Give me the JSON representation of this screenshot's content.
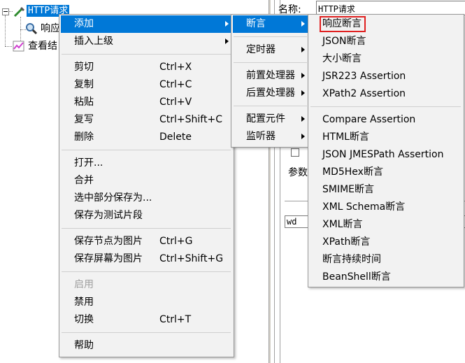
{
  "tree": {
    "items": [
      {
        "label": "HTTP请求",
        "icon": "pipette-icon",
        "selected": true
      },
      {
        "label": "响应",
        "icon": "magnifier-icon"
      },
      {
        "label": "查看结",
        "icon": "graph-icon"
      }
    ]
  },
  "right_panel": {
    "name_label": "名称:",
    "name_value": "HTTP请求",
    "params_label": "参数",
    "field_value": "wd"
  },
  "main_menu": [
    {
      "label": "添加",
      "submenu": true,
      "highlighted": true
    },
    {
      "label": "插入上级",
      "submenu": true
    },
    {
      "separator": true
    },
    {
      "label": "剪切",
      "shortcut": "Ctrl+X"
    },
    {
      "label": "复制",
      "shortcut": "Ctrl+C"
    },
    {
      "label": "粘贴",
      "shortcut": "Ctrl+V"
    },
    {
      "label": "复写",
      "shortcut": "Ctrl+Shift+C"
    },
    {
      "label": "删除",
      "shortcut": "Delete"
    },
    {
      "separator": true
    },
    {
      "label": "打开..."
    },
    {
      "label": "合并"
    },
    {
      "label": "选中部分保存为..."
    },
    {
      "label": "保存为测试片段"
    },
    {
      "separator": true
    },
    {
      "label": "保存节点为图片",
      "shortcut": "Ctrl+G"
    },
    {
      "label": "保存屏幕为图片",
      "shortcut": "Ctrl+Shift+G"
    },
    {
      "separator": true
    },
    {
      "label": "启用",
      "disabled": true
    },
    {
      "label": "禁用"
    },
    {
      "label": "切换",
      "shortcut": "Ctrl+T"
    },
    {
      "separator": true
    },
    {
      "label": "帮助"
    }
  ],
  "add_submenu": [
    {
      "label": "断言",
      "submenu": true,
      "highlighted": true
    },
    {
      "separator": true
    },
    {
      "label": "定时器",
      "submenu": true
    },
    {
      "separator": true
    },
    {
      "label": "前置处理器",
      "submenu": true
    },
    {
      "label": "后置处理器",
      "submenu": true
    },
    {
      "separator": true
    },
    {
      "label": "配置元件",
      "submenu": true
    },
    {
      "label": "监听器",
      "submenu": true
    }
  ],
  "assertion_submenu": [
    {
      "label": "响应断言",
      "boxed": true
    },
    {
      "label": "JSON断言"
    },
    {
      "label": "大小断言"
    },
    {
      "label": "JSR223 Assertion"
    },
    {
      "label": "XPath2 Assertion"
    },
    {
      "separator": true
    },
    {
      "label": "Compare Assertion"
    },
    {
      "label": "HTML断言"
    },
    {
      "label": "JSON JMESPath Assertion"
    },
    {
      "label": "MD5Hex断言"
    },
    {
      "label": "SMIME断言"
    },
    {
      "label": "XML Schema断言"
    },
    {
      "label": "XML断言"
    },
    {
      "label": "XPath断言"
    },
    {
      "label": "断言持续时间"
    },
    {
      "label": "BeanShell断言"
    }
  ],
  "colors": {
    "highlight": "#0078d7",
    "box": "#e02020",
    "menu_bg": "#f2f2f2"
  }
}
